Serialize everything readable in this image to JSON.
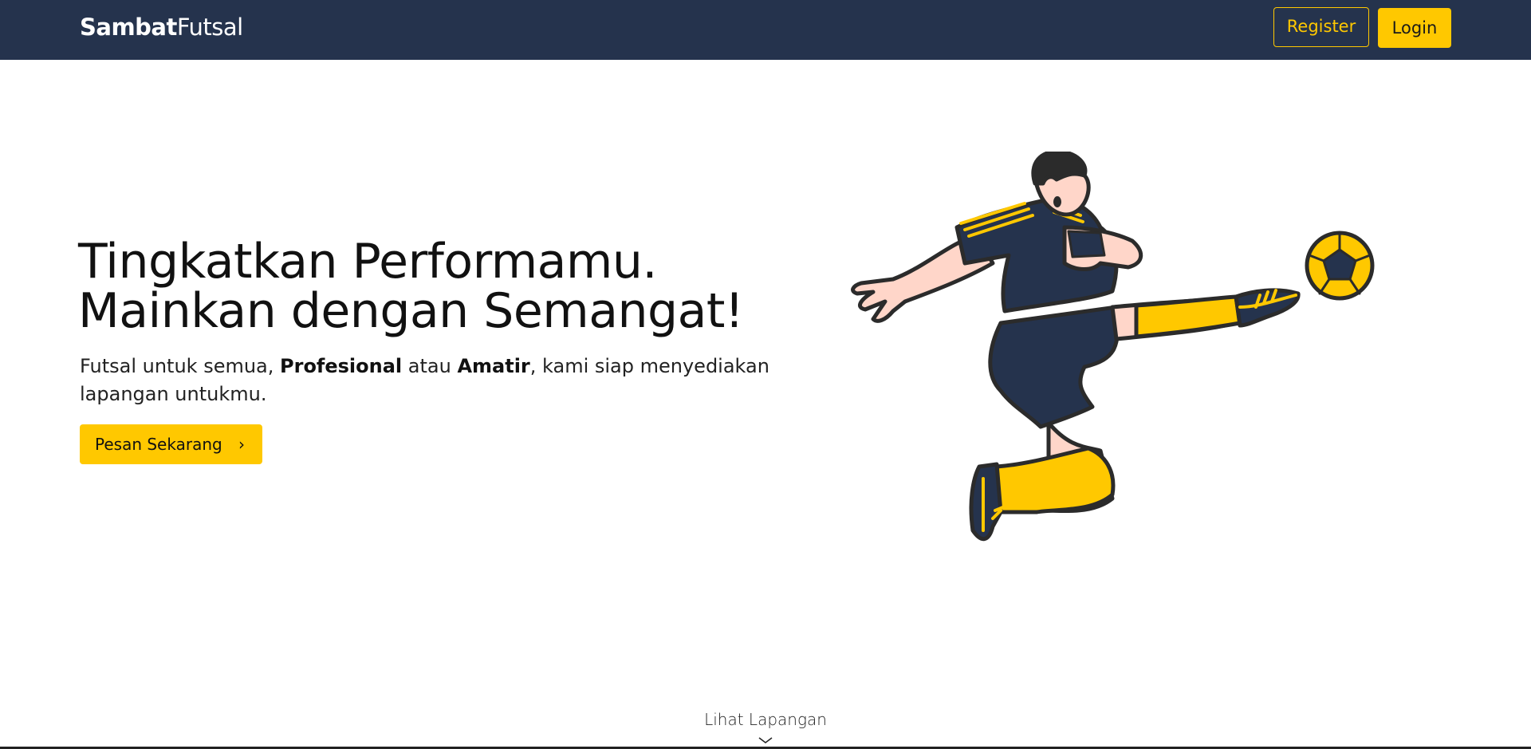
{
  "brand": {
    "part1": "Sambat",
    "part2": "Futsal"
  },
  "nav": {
    "register": "Register",
    "login": "Login"
  },
  "hero": {
    "title_line1": "Tingkatkan Performamu.",
    "title_line2": "Mainkan dengan Semangat!",
    "sub_1": "Futsal untuk semua, ",
    "sub_bold_1": "Profesional",
    "sub_2": " atau ",
    "sub_bold_2": "Amatir",
    "sub_3": ", kami siap menyediakan lapangan untukmu.",
    "cta": "Pesan Sekarang"
  },
  "footer": {
    "see_more": "Lihat Lapangan"
  },
  "colors": {
    "navbar": "#25334d",
    "accent": "#ffc800",
    "text": "#111111"
  },
  "icons": {
    "cta": "chevron-right-icon",
    "see_more": "chevron-down-icon"
  }
}
